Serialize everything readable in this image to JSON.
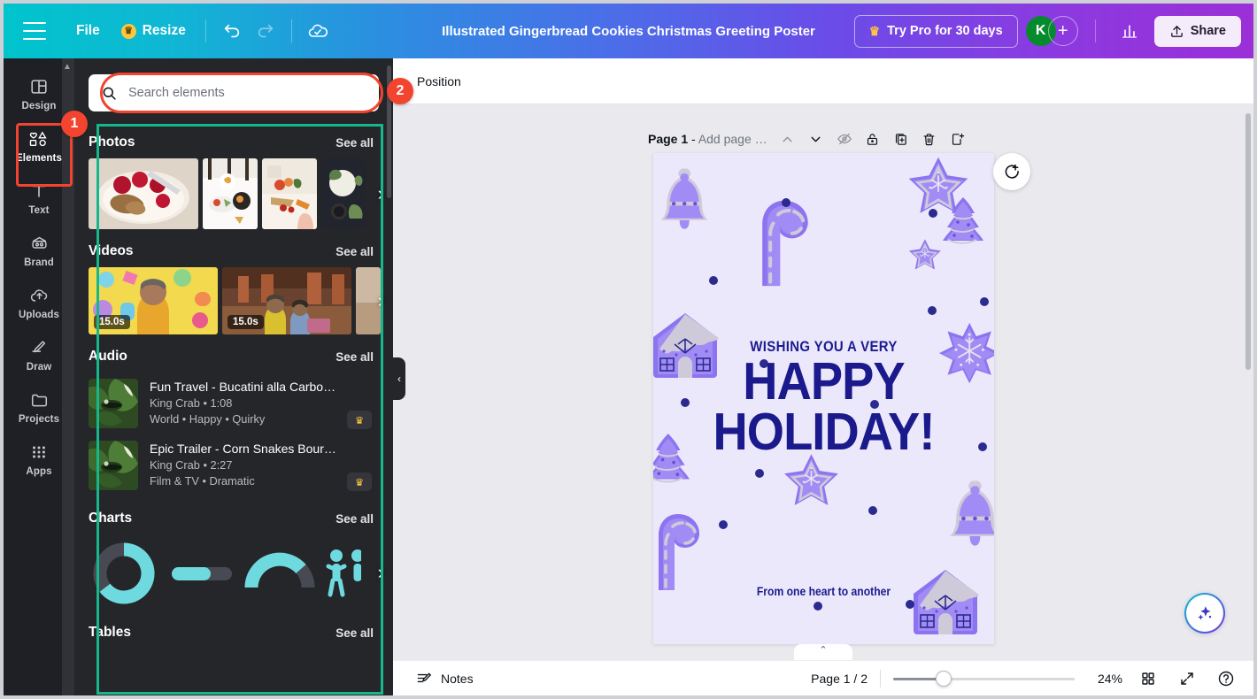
{
  "topbar": {
    "menu_icon": "hamburger-icon",
    "file_label": "File",
    "resize_label": "Resize",
    "undo_icon": "undo-icon",
    "redo_icon": "redo-icon",
    "cloud_icon": "cloud-saved-icon",
    "title": "Illustrated Gingerbread Cookies Christmas Greeting Poster",
    "try_pro_label": "Try Pro for 30 days",
    "avatar_initial": "K",
    "plus_label": "+",
    "insights_icon": "bar-chart-icon",
    "share_label": "Share",
    "share_icon": "upload-icon"
  },
  "sidebar": {
    "items": [
      {
        "label": "Design",
        "icon": "layout-icon",
        "active": false
      },
      {
        "label": "Elements",
        "icon": "shapes-icon",
        "active": true
      },
      {
        "label": "Text",
        "icon": "text-icon",
        "active": false
      },
      {
        "label": "Brand",
        "icon": "brand-icon",
        "active": false
      },
      {
        "label": "Uploads",
        "icon": "upload-cloud-icon",
        "active": false
      },
      {
        "label": "Draw",
        "icon": "pen-icon",
        "active": false
      },
      {
        "label": "Projects",
        "icon": "folder-icon",
        "active": false
      },
      {
        "label": "Apps",
        "icon": "grid-dots-icon",
        "active": false
      }
    ]
  },
  "annotations": {
    "badge_1": "1",
    "badge_2": "2",
    "highlight_color": "#f3442f",
    "content_outline_color": "#15b88a"
  },
  "panel": {
    "search": {
      "placeholder": "Search elements",
      "value": "",
      "icon": "search-icon"
    },
    "see_all_label": "See all",
    "sections": [
      {
        "title": "Photos"
      },
      {
        "title": "Videos"
      },
      {
        "title": "Audio"
      },
      {
        "title": "Charts"
      },
      {
        "title": "Tables"
      }
    ],
    "video_durations": [
      "15.0s",
      "15.0s"
    ],
    "audio": [
      {
        "title": "Fun Travel - Bucatini alla Carbo…",
        "artist_duration": "King Crab • 1:08",
        "tags": "World • Happy • Quirky",
        "pro_badge": "♛"
      },
      {
        "title": "Epic Trailer - Corn Snakes Bour…",
        "artist_duration": "King Crab • 2:27",
        "tags": "Film & TV • Dramatic",
        "pro_badge": "♛"
      }
    ],
    "collapse_icon": "chevron-left-icon"
  },
  "toolbar": {
    "position_label": "Position"
  },
  "page_header": {
    "page_label": "Page 1",
    "dash": " - ",
    "add_title_placeholder": "Add page …",
    "icons": [
      "chevron-up-icon",
      "chevron-down-icon",
      "hide-page-icon",
      "lock-icon",
      "duplicate-page-icon",
      "delete-page-icon",
      "add-page-icon"
    ]
  },
  "canvas": {
    "comment_icon": "add-comment-icon",
    "magic_icon": "sparkle-icon",
    "page_tab_icon": "chevron-up-icon"
  },
  "poster": {
    "line1": "WISHING YOU A VERY",
    "line2": "HAPPY",
    "line3": "HOLIDAY!",
    "line4": "From one heart to another",
    "background": "#ece8fb",
    "text_color": "#1a1a8c",
    "cookie_color": "#a18cf5",
    "cookie_icing": "#cfcad9"
  },
  "bottombar": {
    "notes_label": "Notes",
    "notes_icon": "notes-icon",
    "page_count": "Page 1 / 2",
    "zoom_value": "24%",
    "zoom_percent": 24,
    "grid_icon": "grid-view-icon",
    "fullscreen_icon": "expand-icon",
    "help_icon": "help-icon"
  }
}
